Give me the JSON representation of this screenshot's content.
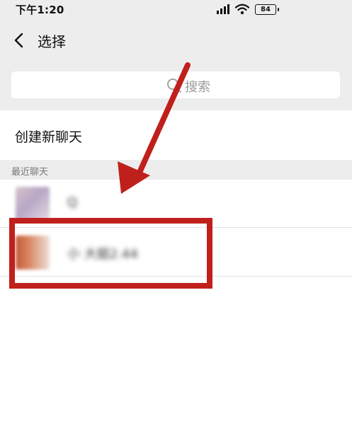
{
  "status_bar": {
    "time": "下午1:20",
    "battery": "84",
    "icons": [
      "signal-icon",
      "wifi-icon",
      "battery-icon"
    ]
  },
  "header": {
    "back_icon": "chevron-left-icon",
    "title": "选择"
  },
  "search": {
    "icon": "search-icon",
    "placeholder": "搜索"
  },
  "new_chat": {
    "label": "创建新聊天"
  },
  "recent": {
    "label": "最近聊天",
    "items": [
      {
        "name": "Q"
      },
      {
        "name": "小 大姐2.44"
      }
    ]
  },
  "annotation": {
    "color": "#c0201c",
    "arrow_icon": "red-arrow-annotation",
    "box_icon": "red-box-annotation"
  }
}
